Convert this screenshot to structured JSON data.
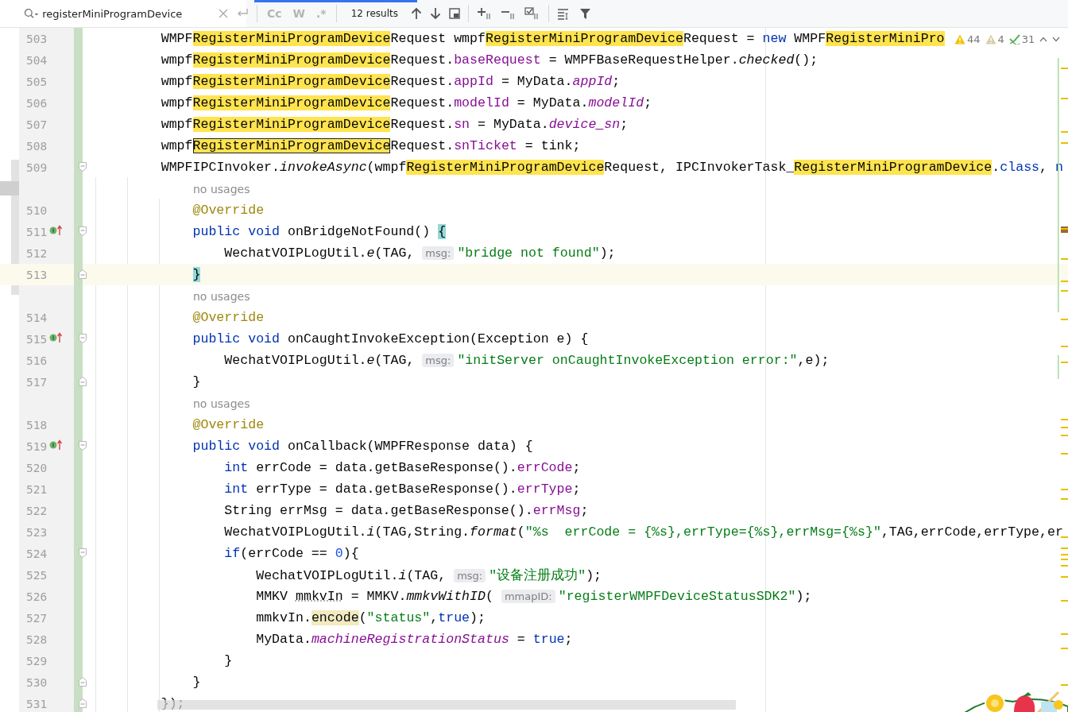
{
  "find_bar": {
    "query": "registerMiniProgramDevice",
    "options": [
      {
        "label": "Cc",
        "selected": false
      },
      {
        "label": "W",
        "selected": false
      },
      {
        "label": ".*",
        "selected": false
      }
    ],
    "result_count": "12 results"
  },
  "inspection_widget": [
    {
      "kind": "warning",
      "count": "44"
    },
    {
      "kind": "weak-warning",
      "count": "4"
    },
    {
      "kind": "typo",
      "count": "31"
    }
  ],
  "editor": {
    "rows": [
      {
        "kind": "code",
        "number": "503",
        "current": false,
        "tokens": [
          {
            "kind": "plain",
            "text": "        WMPF"
          },
          {
            "kind": "match",
            "text": "RegisterMiniProgramDevice"
          },
          {
            "kind": "plain",
            "text": "Request wmpf"
          },
          {
            "kind": "match",
            "text": "RegisterMiniProgramDevice"
          },
          {
            "kind": "plain",
            "text": "Request = "
          },
          {
            "kind": "keyword",
            "text": "new"
          },
          {
            "kind": "plain",
            "text": " WMPF"
          },
          {
            "kind": "match",
            "text": "RegisterMiniPro"
          }
        ]
      },
      {
        "kind": "code",
        "number": "504",
        "current": false,
        "tokens": [
          {
            "kind": "plain",
            "text": "        wmpf"
          },
          {
            "kind": "match",
            "text": "RegisterMiniProgramDevice"
          },
          {
            "kind": "plain",
            "text": "Request."
          },
          {
            "kind": "field",
            "text": "baseRequest"
          },
          {
            "kind": "plain",
            "text": " = WMPFBaseRequestHelper."
          },
          {
            "kind": "italic",
            "text": "checked"
          },
          {
            "kind": "plain",
            "text": "();"
          }
        ]
      },
      {
        "kind": "code",
        "number": "505",
        "current": false,
        "tokens": [
          {
            "kind": "plain",
            "text": "        wmpf"
          },
          {
            "kind": "match",
            "text": "RegisterMiniProgramDevice"
          },
          {
            "kind": "plain",
            "text": "Request."
          },
          {
            "kind": "field",
            "text": "appId"
          },
          {
            "kind": "plain",
            "text": " = MyData."
          },
          {
            "kind": "static",
            "text": "appId"
          },
          {
            "kind": "plain",
            "text": ";"
          }
        ]
      },
      {
        "kind": "code",
        "number": "506",
        "current": false,
        "tokens": [
          {
            "kind": "plain",
            "text": "        wmpf"
          },
          {
            "kind": "match",
            "text": "RegisterMiniProgramDevice"
          },
          {
            "kind": "plain",
            "text": "Request."
          },
          {
            "kind": "field",
            "text": "modelId"
          },
          {
            "kind": "plain",
            "text": " = MyData."
          },
          {
            "kind": "static",
            "text": "modelId"
          },
          {
            "kind": "plain",
            "text": ";"
          }
        ]
      },
      {
        "kind": "code",
        "number": "507",
        "current": false,
        "tokens": [
          {
            "kind": "plain",
            "text": "        wmpf"
          },
          {
            "kind": "match",
            "text": "RegisterMiniProgramDevice"
          },
          {
            "kind": "plain",
            "text": "Request."
          },
          {
            "kind": "field",
            "text": "sn"
          },
          {
            "kind": "plain",
            "text": " = MyData."
          },
          {
            "kind": "static",
            "text": "device_sn"
          },
          {
            "kind": "plain",
            "text": ";"
          }
        ]
      },
      {
        "kind": "code",
        "number": "508",
        "current": false,
        "tokens": [
          {
            "kind": "plain",
            "text": "        wmpf"
          },
          {
            "kind": "match-current",
            "text": "RegisterMiniProgramDevice"
          },
          {
            "kind": "plain",
            "text": "Request."
          },
          {
            "kind": "field",
            "text": "snTicket"
          },
          {
            "kind": "plain",
            "text": " = tink;"
          }
        ]
      },
      {
        "kind": "code",
        "number": "509",
        "current": false,
        "gutter_icons": [
          {
            "kind": "fold-start"
          }
        ],
        "tokens": [
          {
            "kind": "plain",
            "text": "        WMPFIPCInvoker."
          },
          {
            "kind": "italic",
            "text": "invokeAsync"
          },
          {
            "kind": "plain",
            "text": "(wmpf"
          },
          {
            "kind": "match",
            "text": "RegisterMiniProgramDevice"
          },
          {
            "kind": "plain",
            "text": "Request, IPCInvokerTask_"
          },
          {
            "kind": "match",
            "text": "RegisterMiniProgramDevice"
          },
          {
            "kind": "plain",
            "text": "."
          },
          {
            "kind": "keyword",
            "text": "class"
          },
          {
            "kind": "plain",
            "text": ", "
          },
          {
            "kind": "keyword",
            "text": "n"
          }
        ]
      },
      {
        "kind": "usages",
        "text": "no usages"
      },
      {
        "kind": "code",
        "number": "510",
        "current": false,
        "tokens": [
          {
            "kind": "annotation",
            "text": "            @Override"
          }
        ]
      },
      {
        "kind": "code",
        "number": "511",
        "current": false,
        "gutter_icons": [
          {
            "kind": "override"
          },
          {
            "kind": "fold-start"
          }
        ],
        "tokens": [
          {
            "kind": "keyword",
            "text": "            public void"
          },
          {
            "kind": "plain",
            "text": " onBridgeNotFound() "
          },
          {
            "kind": "brace",
            "text": "{"
          }
        ]
      },
      {
        "kind": "code",
        "number": "512",
        "current": false,
        "tokens": [
          {
            "kind": "plain",
            "text": "                WechatVOIPLogUtil."
          },
          {
            "kind": "italic",
            "text": "e"
          },
          {
            "kind": "plain",
            "text": "(TAG, "
          },
          {
            "kind": "hint",
            "text": "msg:"
          },
          {
            "kind": "string",
            "text": "\"bridge not found\""
          },
          {
            "kind": "plain",
            "text": ");"
          }
        ]
      },
      {
        "kind": "code",
        "number": "513",
        "current": true,
        "gutter_icons": [
          {
            "kind": "fold-end"
          }
        ],
        "tokens": [
          {
            "kind": "brace",
            "text": "            }"
          }
        ]
      },
      {
        "kind": "usages",
        "text": "no usages"
      },
      {
        "kind": "code",
        "number": "514",
        "current": false,
        "tokens": [
          {
            "kind": "annotation",
            "text": "            @Override"
          }
        ]
      },
      {
        "kind": "code",
        "number": "515",
        "current": false,
        "gutter_icons": [
          {
            "kind": "override"
          },
          {
            "kind": "fold-start"
          }
        ],
        "tokens": [
          {
            "kind": "keyword",
            "text": "            public void"
          },
          {
            "kind": "plain",
            "text": " onCaughtInvokeException(Exception e) {"
          }
        ]
      },
      {
        "kind": "code",
        "number": "516",
        "current": false,
        "tokens": [
          {
            "kind": "plain",
            "text": "                WechatVOIPLogUtil."
          },
          {
            "kind": "italic",
            "text": "e"
          },
          {
            "kind": "plain",
            "text": "(TAG, "
          },
          {
            "kind": "hint",
            "text": "msg:"
          },
          {
            "kind": "string",
            "text": "\"initServer onCaughtInvokeException error:\""
          },
          {
            "kind": "plain",
            "text": ",e);"
          }
        ]
      },
      {
        "kind": "code",
        "number": "517",
        "current": false,
        "gutter_icons": [
          {
            "kind": "fold-end"
          }
        ],
        "tokens": [
          {
            "kind": "plain",
            "text": "            }"
          }
        ]
      },
      {
        "kind": "usages",
        "text": "no usages"
      },
      {
        "kind": "code",
        "number": "518",
        "current": false,
        "tokens": [
          {
            "kind": "annotation",
            "text": "            @Override"
          }
        ]
      },
      {
        "kind": "code",
        "number": "519",
        "current": false,
        "gutter_icons": [
          {
            "kind": "override"
          },
          {
            "kind": "fold-start"
          }
        ],
        "tokens": [
          {
            "kind": "keyword",
            "text": "            public void"
          },
          {
            "kind": "plain",
            "text": " onCallback(WMPFResponse data) {"
          }
        ]
      },
      {
        "kind": "code",
        "number": "520",
        "current": false,
        "tokens": [
          {
            "kind": "keyword",
            "text": "                int"
          },
          {
            "kind": "plain",
            "text": " errCode = data.getBaseResponse()."
          },
          {
            "kind": "field",
            "text": "errCode"
          },
          {
            "kind": "plain",
            "text": ";"
          }
        ]
      },
      {
        "kind": "code",
        "number": "521",
        "current": false,
        "tokens": [
          {
            "kind": "keyword",
            "text": "                int"
          },
          {
            "kind": "plain",
            "text": " errType = data.getBaseResponse()."
          },
          {
            "kind": "field",
            "text": "errType"
          },
          {
            "kind": "plain",
            "text": ";"
          }
        ]
      },
      {
        "kind": "code",
        "number": "522",
        "current": false,
        "tokens": [
          {
            "kind": "plain",
            "text": "                String errMsg = data.getBaseResponse()."
          },
          {
            "kind": "field",
            "text": "errMsg"
          },
          {
            "kind": "plain",
            "text": ";"
          }
        ]
      },
      {
        "kind": "code",
        "number": "523",
        "current": false,
        "tokens": [
          {
            "kind": "plain",
            "text": "                WechatVOIPLogUtil."
          },
          {
            "kind": "italic",
            "text": "i"
          },
          {
            "kind": "plain",
            "text": "(TAG,String."
          },
          {
            "kind": "italic",
            "text": "format"
          },
          {
            "kind": "plain",
            "text": "("
          },
          {
            "kind": "string",
            "text": "\"%s  errCode = {%s},errType={%s},errMsg={%s}\""
          },
          {
            "kind": "plain",
            "text": ",TAG,errCode,errType,er"
          }
        ]
      },
      {
        "kind": "code",
        "number": "524",
        "current": false,
        "gutter_icons": [
          {
            "kind": "fold-start"
          }
        ],
        "tokens": [
          {
            "kind": "keyword",
            "text": "                if"
          },
          {
            "kind": "plain",
            "text": "(errCode == "
          },
          {
            "kind": "number",
            "text": "0"
          },
          {
            "kind": "plain",
            "text": "){"
          }
        ]
      },
      {
        "kind": "code",
        "number": "525",
        "current": false,
        "tokens": [
          {
            "kind": "plain",
            "text": "                    WechatVOIPLogUtil."
          },
          {
            "kind": "italic",
            "text": "i"
          },
          {
            "kind": "plain",
            "text": "(TAG, "
          },
          {
            "kind": "hint",
            "text": "msg:"
          },
          {
            "kind": "string",
            "text": "\"设备注册成功\""
          },
          {
            "kind": "plain",
            "text": ");"
          }
        ]
      },
      {
        "kind": "code",
        "number": "526",
        "current": false,
        "tokens": [
          {
            "kind": "plain",
            "text": "                    MMKV "
          },
          {
            "kind": "underlined",
            "text": "mmkvIn"
          },
          {
            "kind": "plain",
            "text": " = MMKV."
          },
          {
            "kind": "italic",
            "text": "mmkvWithID"
          },
          {
            "kind": "plain",
            "text": "( "
          },
          {
            "kind": "hint",
            "text": "mmapID:"
          },
          {
            "kind": "string",
            "text": "\"registerWMPFDeviceStatusSDK2\""
          },
          {
            "kind": "plain",
            "text": ");"
          }
        ]
      },
      {
        "kind": "code",
        "number": "527",
        "current": false,
        "tokens": [
          {
            "kind": "plain",
            "text": "                    mmkvIn."
          },
          {
            "kind": "marked",
            "text": "encode"
          },
          {
            "kind": "plain",
            "text": "("
          },
          {
            "kind": "string",
            "text": "\"status\""
          },
          {
            "kind": "plain",
            "text": ","
          },
          {
            "kind": "keyword",
            "text": "true"
          },
          {
            "kind": "plain",
            "text": ");"
          }
        ]
      },
      {
        "kind": "code",
        "number": "528",
        "current": false,
        "tokens": [
          {
            "kind": "plain",
            "text": "                    MyData."
          },
          {
            "kind": "static",
            "text": "machineRegistrationStatus"
          },
          {
            "kind": "plain",
            "text": " = "
          },
          {
            "kind": "keyword",
            "text": "true"
          },
          {
            "kind": "plain",
            "text": ";"
          }
        ]
      },
      {
        "kind": "code",
        "number": "529",
        "current": false,
        "tokens": [
          {
            "kind": "plain",
            "text": "                }"
          }
        ]
      },
      {
        "kind": "code",
        "number": "530",
        "current": false,
        "gutter_icons": [
          {
            "kind": "fold-end"
          }
        ],
        "tokens": [
          {
            "kind": "plain",
            "text": "            }"
          }
        ]
      },
      {
        "kind": "code",
        "number": "531",
        "current": false,
        "gutter_icons": [
          {
            "kind": "fold-end"
          }
        ],
        "tokens": [
          {
            "kind": "plain",
            "text": "        });"
          }
        ]
      }
    ]
  }
}
